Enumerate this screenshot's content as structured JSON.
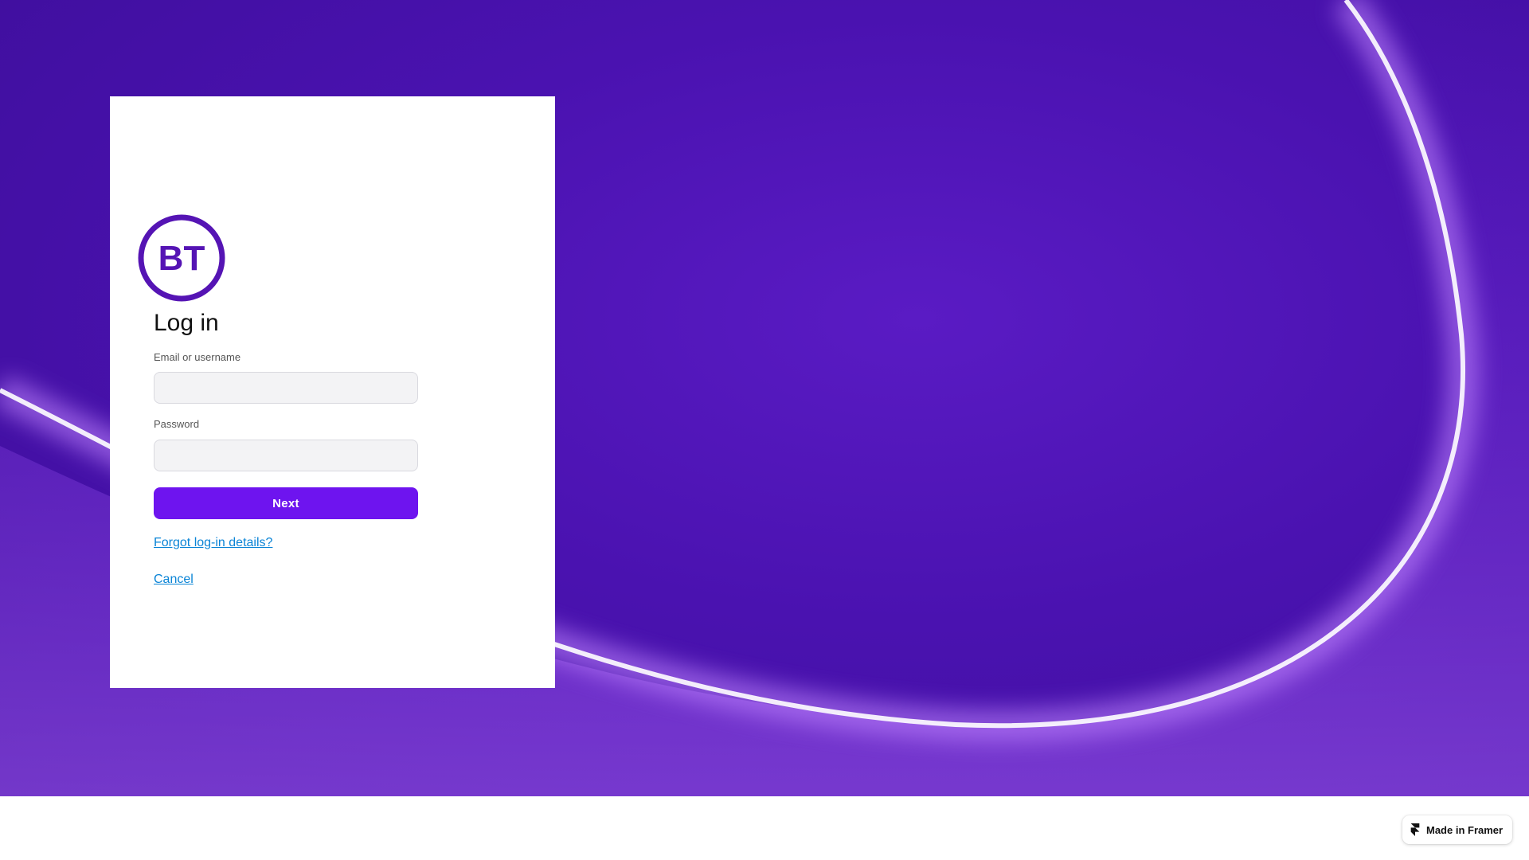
{
  "brand": {
    "logo_text": "BT",
    "color": "#5514b4"
  },
  "login": {
    "title": "Log in",
    "email_label": "Email or username",
    "email_value": "",
    "password_label": "Password",
    "password_value": "",
    "next_label": "Next",
    "forgot_label": "Forgot log-in details?",
    "cancel_label": "Cancel"
  },
  "badge": {
    "label": "Made in Framer",
    "icon": "framer-icon"
  },
  "colors": {
    "accent": "#6e14ef",
    "link": "#0a84d6",
    "background": "#4a12b0"
  }
}
